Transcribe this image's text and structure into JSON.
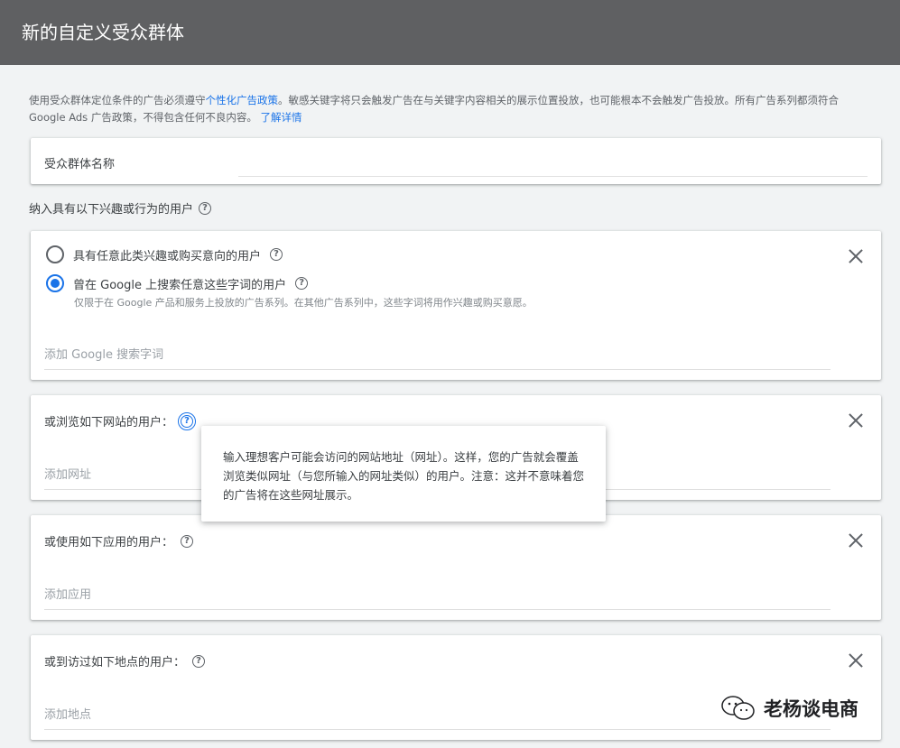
{
  "dialog": {
    "title": "新的自定义受众群体"
  },
  "notice": {
    "text_before": "使用受众群体定位条件的广告必须遵守",
    "policy_link": "个性化广告政策",
    "text_after": "。敏感关键字将只会触发广告在与关键字内容相关的展示位置投放，也可能根本不会触发广告投放。所有广告系列都须符合 Google Ads 广告政策，不得包含任何不良内容。",
    "learn_more": "了解详情"
  },
  "name_field": {
    "label": "受众群体名称",
    "value": ""
  },
  "include_section": {
    "label": "纳入具有以下兴趣或行为的用户"
  },
  "interest_card": {
    "options": [
      {
        "label": "具有任意此类兴趣或购买意向的用户",
        "selected": false
      },
      {
        "label": "曾在 Google 上搜索任意这些字词的用户",
        "selected": true
      }
    ],
    "note": "仅限于在 Google 产品和服务上投放的广告系列。在其他广告系列中，这些字词将用作兴趣或购买意愿。",
    "placeholder": "添加 Google 搜索字词"
  },
  "url_card": {
    "label": "或浏览如下网站的用户：",
    "placeholder": "添加网址"
  },
  "app_card": {
    "label": "或使用如下应用的用户：",
    "placeholder": "添加应用"
  },
  "place_card": {
    "label": "或到访过如下地点的用户：",
    "placeholder": "添加地点"
  },
  "tooltip": {
    "text": "输入理想客户可能会访问的网站地址（网址）。这样，您的广告就会覆盖浏览类似网址（与您所输入的网址类似）的用户。注意：这并不意味着您的广告将在这些网址展示。"
  },
  "watermark": {
    "text": "老杨谈电商"
  },
  "colors": {
    "titlebar": "#5f6062",
    "accent": "#1a73e8",
    "background": "#f1f3f4"
  }
}
